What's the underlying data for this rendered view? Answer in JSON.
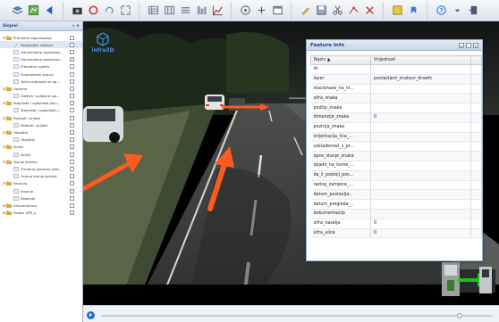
{
  "window": {
    "title": ""
  },
  "sidebar": {
    "header": "Slojevi",
    "header_controls": "« ×",
    "items": [
      {
        "label": "Prometna signalizacija",
        "level": 0,
        "expander": "⊟",
        "icon": "folder",
        "checked": false,
        "selected": false
      },
      {
        "label": "Postavljeni znakovi",
        "level": 1,
        "expander": "",
        "icon": "layer-edit",
        "checked": false,
        "selected": true
      },
      {
        "label": "Horizontalna signalizac...",
        "level": 1,
        "expander": "",
        "icon": "layer",
        "checked": false,
        "selected": false
      },
      {
        "label": "Horizontalna signalizac...",
        "level": 1,
        "expander": "",
        "icon": "layer",
        "checked": true,
        "selected": false
      },
      {
        "label": "Prometna svjetla",
        "level": 1,
        "expander": "",
        "icon": "layer",
        "checked": false,
        "selected": false
      },
      {
        "label": "Smjerokazni stupici",
        "level": 1,
        "expander": "",
        "icon": "layer",
        "checked": false,
        "selected": false
      },
      {
        "label": "Točne prepreke za op...",
        "level": 1,
        "expander": "",
        "icon": "layer",
        "checked": false,
        "selected": false
      },
      {
        "label": "Oprema",
        "level": 0,
        "expander": "⊟",
        "icon": "folder",
        "checked": false,
        "selected": false
      },
      {
        "label": "Zaštitni i odbojna ogr...",
        "level": 1,
        "expander": "",
        "icon": "layer",
        "checked": false,
        "selected": false
      },
      {
        "label": "Stajalista i ugibalista javn...",
        "level": 0,
        "expander": "⊟",
        "icon": "folder",
        "checked": false,
        "selected": false
      },
      {
        "label": "Stajalista i ugibalista j...",
        "level": 1,
        "expander": "",
        "icon": "layer",
        "checked": false,
        "selected": false
      },
      {
        "label": "Pothodi i prijlazi",
        "level": 0,
        "expander": "⊟",
        "icon": "folder",
        "checked": false,
        "selected": false
      },
      {
        "label": "Pothodi i prijlazi",
        "level": 1,
        "expander": "",
        "icon": "layer",
        "checked": false,
        "selected": false
      },
      {
        "label": "Otpuštni",
        "level": 0,
        "expander": "⊟",
        "icon": "folder",
        "checked": false,
        "selected": false
      },
      {
        "label": "Otpuštni",
        "level": 1,
        "expander": "",
        "icon": "layer",
        "checked": false,
        "selected": false
      },
      {
        "label": "Kolnik",
        "level": 0,
        "expander": "⊟",
        "icon": "folder",
        "checked": false,
        "selected": false
      },
      {
        "label": "Kolnik",
        "level": 1,
        "expander": "",
        "icon": "layer",
        "checked": false,
        "selected": false
      },
      {
        "label": "Stanje kolnika",
        "level": 0,
        "expander": "⊟",
        "icon": "folder",
        "checked": false,
        "selected": false
      },
      {
        "label": "Vizualno opazene oste...",
        "level": 1,
        "expander": "",
        "icon": "layer",
        "checked": false,
        "selected": false
      },
      {
        "label": "Ocjena stanja kolnika",
        "level": 1,
        "expander": "",
        "icon": "layer",
        "checked": false,
        "selected": false
      },
      {
        "label": "Raskrija",
        "level": 0,
        "expander": "⊟",
        "icon": "folder",
        "checked": false,
        "selected": false
      },
      {
        "label": "Krsanje",
        "level": 1,
        "expander": "",
        "icon": "layer",
        "checked": false,
        "selected": false
      },
      {
        "label": "Raskrsje",
        "level": 1,
        "expander": "",
        "icon": "layer",
        "checked": false,
        "selected": false
      },
      {
        "label": "Infrastruktura",
        "level": 0,
        "expander": "⊞",
        "icon": "folder",
        "checked": false,
        "selected": false
      },
      {
        "label": "Podaci GPS_a",
        "level": 0,
        "expander": "⊞",
        "icon": "folder",
        "checked": false,
        "selected": false
      }
    ]
  },
  "viewer": {
    "logo_text": "infra3D"
  },
  "feature_info": {
    "title": "Feature Info",
    "columns": [
      "Naziv ▲",
      "Vrijednost"
    ],
    "rows": [
      [
        "id",
        ""
      ],
      [
        "layer",
        "postavljeni_znakovi_drawfc"
      ],
      [
        "stacionaza_na_ni...",
        ""
      ],
      [
        "sifra_znaka",
        ""
      ],
      [
        "podtip_znaka",
        ""
      ],
      [
        "dimenzije_znaka",
        "0"
      ],
      [
        "pozicija_znaka",
        ""
      ],
      [
        "orijentacija_lica_...",
        ""
      ],
      [
        "uskladenost_s_pr...",
        ""
      ],
      [
        "opce_stanje_znaka",
        ""
      ],
      [
        "objekt_na_kome_...",
        ""
      ],
      [
        "da_li_postoji_pos...",
        ""
      ],
      [
        "razlog_zamjene_...",
        ""
      ],
      [
        "datum_postavlja...",
        ""
      ],
      [
        "datum_pregleda_...",
        ""
      ],
      [
        "dokumentacija",
        ""
      ],
      [
        "sifra_naselja",
        "0"
      ],
      [
        "sifra_ulice",
        "0"
      ]
    ]
  },
  "colors": {
    "accent": "#15428b",
    "arrow": "#ff5a1f",
    "play": "#1a73c9"
  }
}
